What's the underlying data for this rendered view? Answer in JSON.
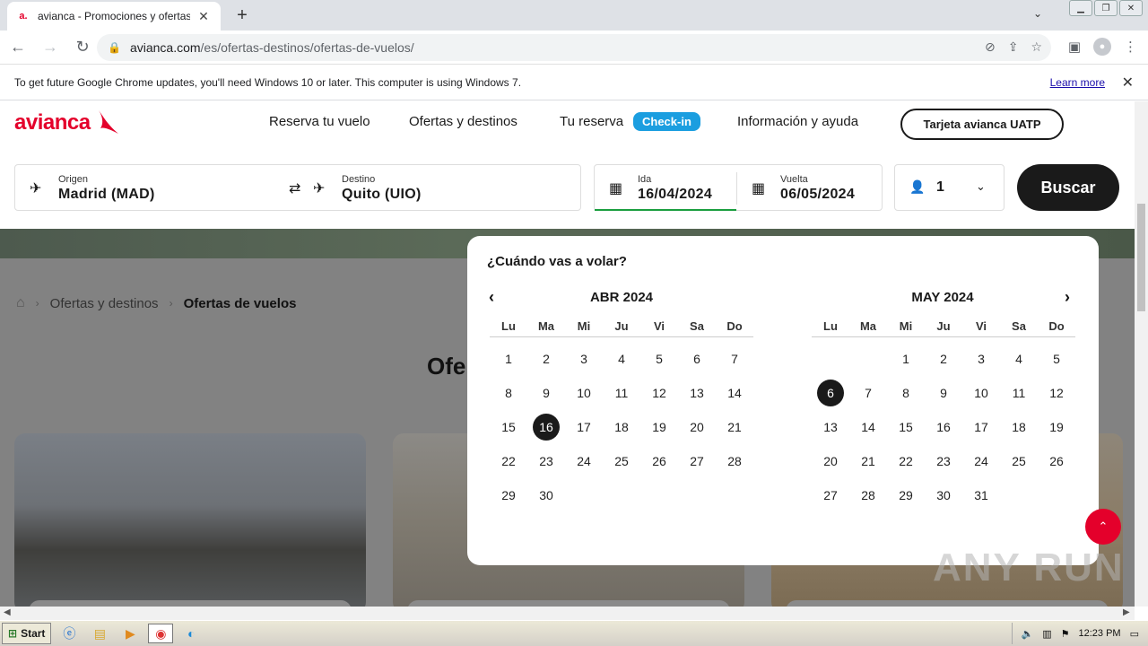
{
  "browser": {
    "tab_title": "avianca - Promociones y ofertas de vuelos",
    "tab_favicon": "a.",
    "new_tab": "+",
    "url_host": "avianca.com",
    "url_path": "/es/ofertas-destinos/ofertas-de-vuelos/"
  },
  "infobar": {
    "message": "To get future Google Chrome updates, you'll need Windows 10 or later. This computer is using Windows 7.",
    "learn_more": "Learn more"
  },
  "site": {
    "logo": "avianca",
    "nav": [
      "Reserva tu vuelo",
      "Ofertas y destinos",
      "Tu reserva",
      "Información y ayuda"
    ],
    "checkin": "Check-in",
    "uatp": "Tarjeta avianca UATP"
  },
  "search": {
    "origin_label": "Origen",
    "origin_value": "Madrid (MAD)",
    "dest_label": "Destino",
    "dest_value": "Quito (UIO)",
    "ida_label": "Ida",
    "ida_value": "16/04/2024",
    "vuelta_label": "Vuelta",
    "vuelta_value": "06/05/2024",
    "passengers": "1",
    "button": "Buscar"
  },
  "breadcrumb": {
    "parent": "Ofertas y destinos",
    "current": "Ofertas de vuelos"
  },
  "heading_partial": "Ofe",
  "calendar": {
    "question": "¿Cuándo vas a volar?",
    "weekdays": [
      "Lu",
      "Ma",
      "Mi",
      "Ju",
      "Vi",
      "Sa",
      "Do"
    ],
    "months": [
      {
        "title": "ABR 2024",
        "offset": 0,
        "days": 30,
        "selected": 16
      },
      {
        "title": "MAY 2024",
        "offset": 2,
        "days": 31,
        "selected": 6
      }
    ]
  },
  "watermark": "ANY RUN",
  "taskbar": {
    "start": "Start",
    "time": "12:23 PM"
  }
}
